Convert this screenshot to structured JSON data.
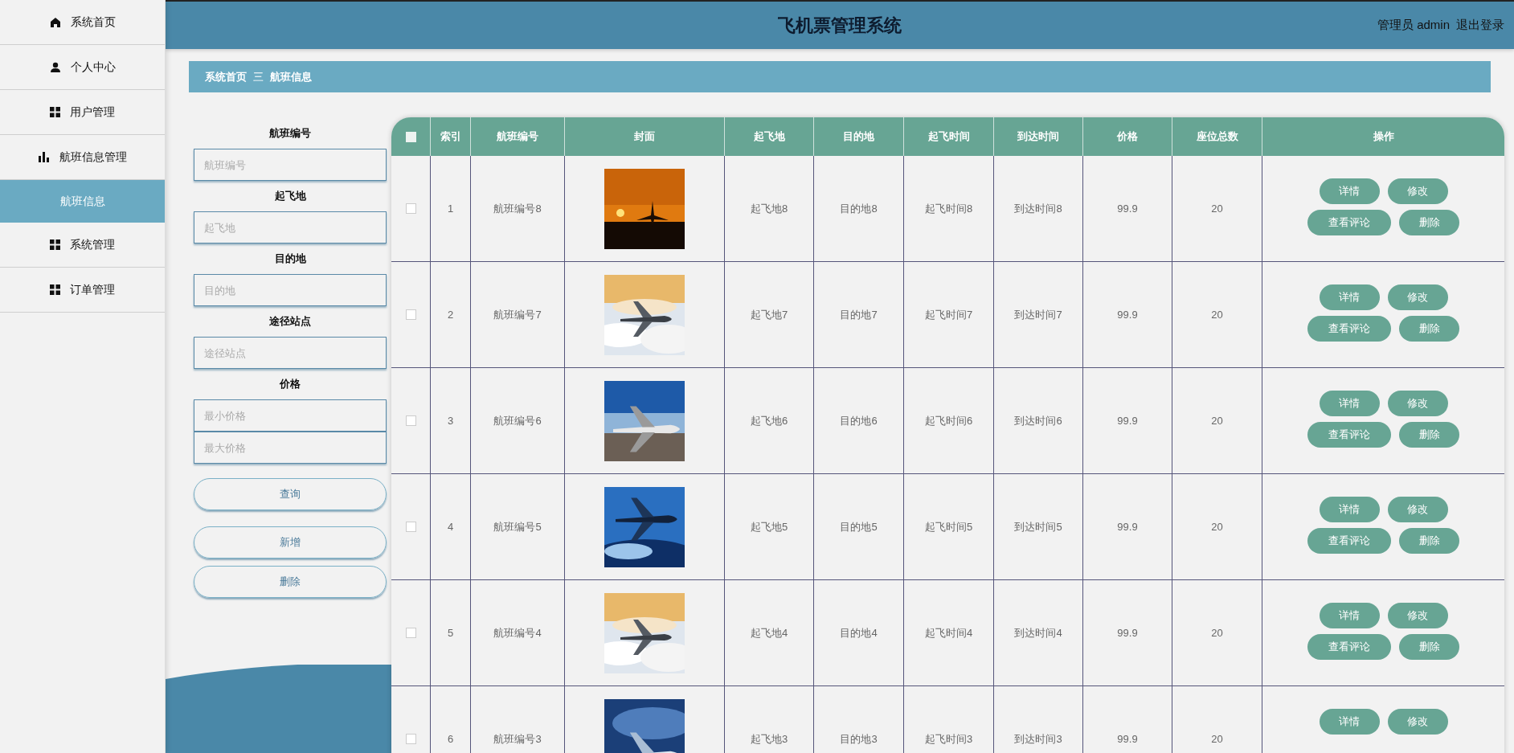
{
  "sidebar": {
    "items": [
      {
        "label": "系统首页",
        "kind": "home",
        "selected": false
      },
      {
        "label": "个人中心",
        "kind": "user",
        "selected": false
      },
      {
        "label": "用户管理",
        "kind": "grid",
        "selected": false
      },
      {
        "label": "航班信息管理",
        "kind": "chart",
        "selected": false
      },
      {
        "label": "航班信息",
        "kind": "plain",
        "selected": true
      },
      {
        "label": "系统管理",
        "kind": "grid",
        "selected": false
      },
      {
        "label": "订单管理",
        "kind": "grid",
        "selected": false
      }
    ]
  },
  "header": {
    "title": "飞机票管理系统",
    "user": "管理员 admin",
    "logout": "退出登录"
  },
  "breadcrumb": {
    "items": [
      "系统首页",
      "航班信息"
    ],
    "separator": "三"
  },
  "search": {
    "groups": [
      {
        "label": "航班编号",
        "fields": [
          {
            "placeholder": "航班编号"
          }
        ]
      },
      {
        "label": "起飞地",
        "fields": [
          {
            "placeholder": "起飞地"
          }
        ]
      },
      {
        "label": "目的地",
        "fields": [
          {
            "placeholder": "目的地"
          }
        ]
      },
      {
        "label": "途径站点",
        "fields": [
          {
            "placeholder": "途径站点"
          }
        ]
      },
      {
        "label": "价格",
        "fields": [
          {
            "placeholder": "最小价格"
          },
          {
            "placeholder": "最大价格"
          }
        ]
      }
    ],
    "buttons": [
      "查询",
      "新增",
      "删除"
    ]
  },
  "table": {
    "select_all": {
      "checked": false
    },
    "columns": [
      "索引",
      "航班编号",
      "封面",
      "起飞地",
      "目的地",
      "起飞时间",
      "到达时间",
      "价格",
      "座位总数",
      "操作"
    ],
    "rows": [
      {
        "checked": false,
        "index": "1",
        "flight_no": "航班编号8",
        "cover": {
          "kind": "picture"
        },
        "origin": "起飞地8",
        "destination": "目的地8",
        "departure": "起飞时间8",
        "arrival": "到达时间8",
        "price": "99.9",
        "seats": "20",
        "actions": [
          "详情",
          "修改",
          "查看评论",
          "删除"
        ]
      },
      {
        "checked": false,
        "index": "2",
        "flight_no": "航班编号7",
        "cover": {
          "kind": "picture"
        },
        "origin": "起飞地7",
        "destination": "目的地7",
        "departure": "起飞时间7",
        "arrival": "到达时间7",
        "price": "99.9",
        "seats": "20",
        "actions": [
          "详情",
          "修改",
          "查看评论",
          "删除"
        ]
      },
      {
        "checked": false,
        "index": "3",
        "flight_no": "航班编号6",
        "cover": {
          "kind": "picture"
        },
        "origin": "起飞地6",
        "destination": "目的地6",
        "departure": "起飞时间6",
        "arrival": "到达时间6",
        "price": "99.9",
        "seats": "20",
        "actions": [
          "详情",
          "修改",
          "查看评论",
          "删除"
        ]
      },
      {
        "checked": false,
        "index": "4",
        "flight_no": "航班编号5",
        "cover": {
          "kind": "picture"
        },
        "origin": "起飞地5",
        "destination": "目的地5",
        "departure": "起飞时间5",
        "arrival": "到达时间5",
        "price": "99.9",
        "seats": "20",
        "actions": [
          "详情",
          "修改",
          "查看评论",
          "删除"
        ]
      },
      {
        "checked": false,
        "index": "5",
        "flight_no": "航班编号4",
        "cover": {
          "kind": "picture"
        },
        "origin": "起飞地4",
        "destination": "目的地4",
        "departure": "起飞时间4",
        "arrival": "到达时间4",
        "price": "99.9",
        "seats": "20",
        "actions": [
          "详情",
          "修改",
          "查看评论",
          "删除"
        ]
      },
      {
        "checked": false,
        "index": "6",
        "flight_no": "航班编号3",
        "cover": {
          "kind": "picture"
        },
        "origin": "起飞地3",
        "destination": "目的地3",
        "departure": "起飞时间3",
        "arrival": "到达时间3",
        "price": "99.9",
        "seats": "20",
        "actions": [
          "详情",
          "修改"
        ]
      }
    ]
  }
}
